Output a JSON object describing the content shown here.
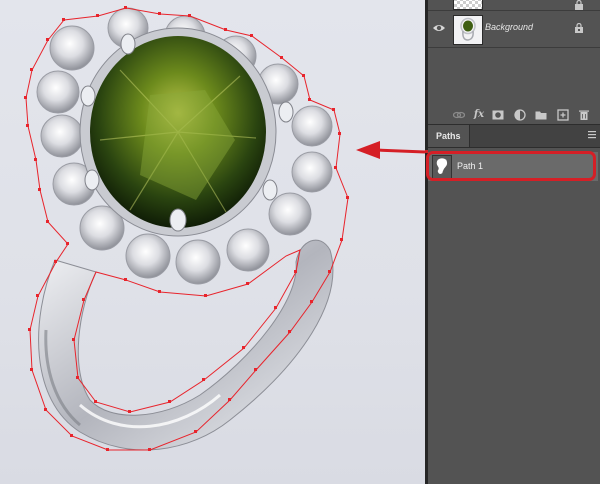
{
  "layers_panel": {
    "layers": [
      {
        "name": "",
        "visible": false,
        "locked": false,
        "thumbnail": "transparent-checker"
      },
      {
        "name": "Background",
        "visible": true,
        "locked": true,
        "thumbnail": "ring-image"
      }
    ],
    "toolbar_icons": [
      "link-icon",
      "fx-icon",
      "mask-icon",
      "adjustment-icon",
      "folder-icon",
      "new-layer-icon",
      "trash-icon"
    ],
    "toolbar_fx_label": "fx"
  },
  "paths_panel": {
    "tab_label": "Paths",
    "paths": [
      {
        "name": "Path 1",
        "selected": true
      }
    ]
  },
  "annotation": {
    "arrow_color": "#d51f26",
    "highlight_color": "#d51f26"
  },
  "canvas": {
    "path_color": "#e8242c"
  }
}
